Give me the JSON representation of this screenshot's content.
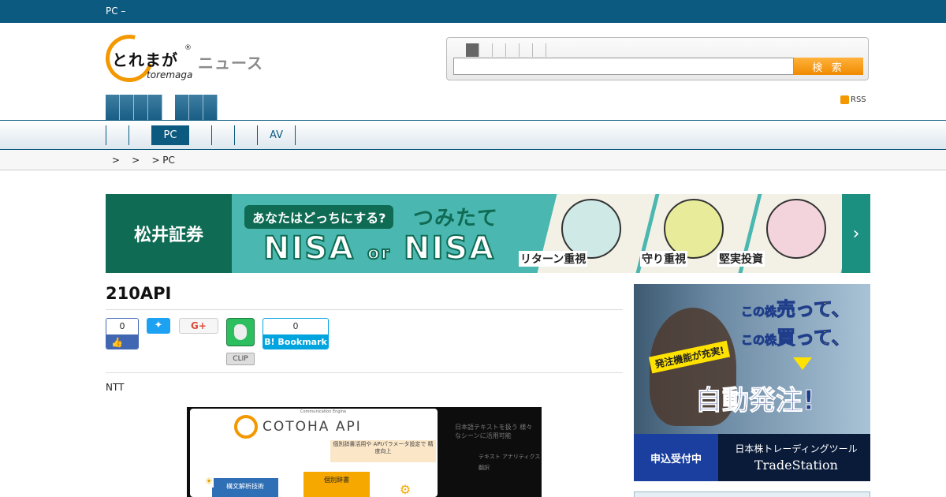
{
  "topbar": {
    "text": "PC –"
  },
  "logo": {
    "jp": "とれまが",
    "reg": "®",
    "roman": "toremaga",
    "news": "ニュース"
  },
  "search": {
    "button": "検 索",
    "value": "",
    "placeholder": ""
  },
  "rss": {
    "label": "RSS"
  },
  "nav": {
    "items": [
      "",
      "PC",
      "",
      "",
      "AV",
      ""
    ]
  },
  "breadcrumb": {
    "text": " >    >    > PC"
  },
  "banner": {
    "brand": "松井証券",
    "question": "あなたはどっちにする?",
    "tsumitate": "つみたて",
    "nisa_left": "NISA",
    "or": "or",
    "nisa_right": "NISA",
    "panels": [
      "リターン重視",
      "守り重視",
      "堅実投資"
    ],
    "arrow": "›"
  },
  "article": {
    "title": "210API",
    "share": {
      "facebook_count": "0",
      "facebook_icon": "thumbs-up-icon",
      "twitter_icon": "twitter-bird-icon",
      "gplus_label": "G+",
      "evernote_icon": "evernote-elephant-icon",
      "clip_label": "CLIP",
      "hatena_count": "0",
      "hatena_label": "B! Bookmark"
    },
    "lead": "NTT"
  },
  "figure": {
    "tagline": "Communication Engine",
    "brand": "COTOHA API",
    "note": "個別辞書活用や APIパラメータ設定で 精度向上",
    "node_left": "構文解析技術",
    "node_mid": "個別辞書",
    "right_text": "日本語テキストを扱う 様々なシーンに活用可能",
    "right_items": [
      "テキスト アナリティクス",
      "翻訳"
    ]
  },
  "side_ad": {
    "line1_pre": "この株",
    "line1_hl": "売って、",
    "line2_pre": "この株",
    "line2_hl": "買って、",
    "badge": "発注機能が充実!",
    "main": "自動発注!",
    "apply": "申込受付中",
    "tool": "日本株トレーディングツール",
    "brand": "TradeStation"
  },
  "colors": {
    "brand_blue": "#0c5a80",
    "accent_orange": "#f39800",
    "banner_green": "#0f6b53"
  }
}
